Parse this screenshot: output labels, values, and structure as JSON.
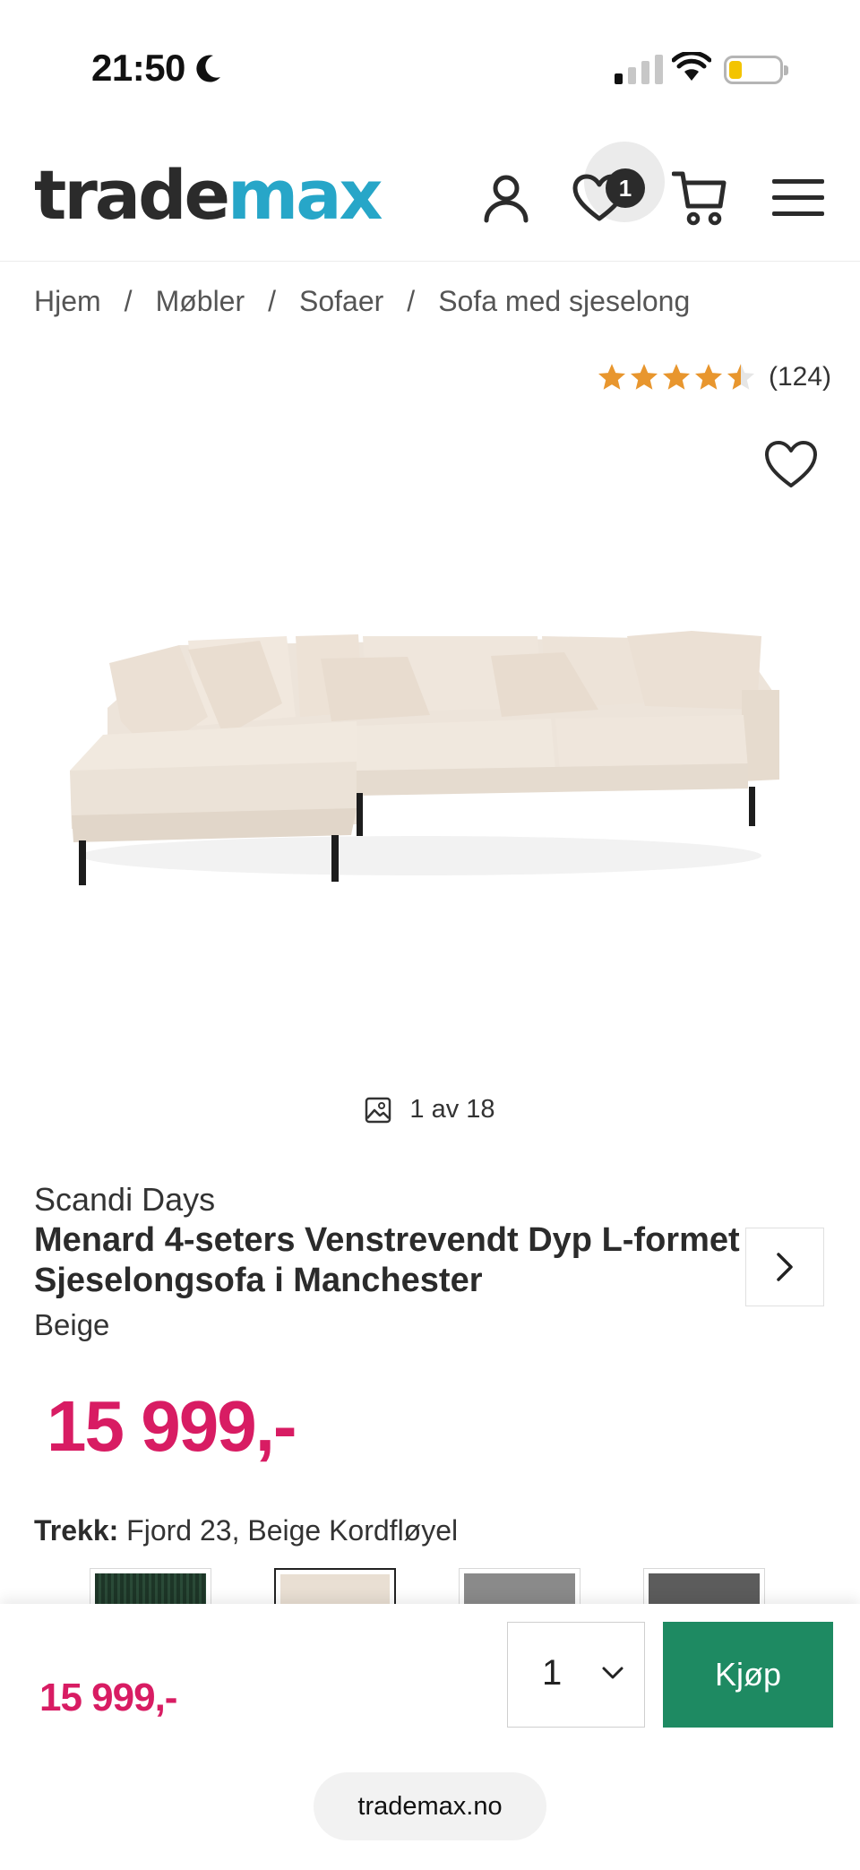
{
  "status_bar": {
    "time": "21:50"
  },
  "header": {
    "logo_part1": "trade",
    "logo_part2": "max",
    "wishlist_count": "1"
  },
  "breadcrumb": {
    "items": [
      "Hjem",
      "Møbler",
      "Sofaer",
      "Sofa med sjeselong"
    ],
    "separator": "/"
  },
  "rating": {
    "stars": 4.5,
    "count": "(124)"
  },
  "gallery": {
    "counter": "1 av 18"
  },
  "product": {
    "brand": "Scandi Days",
    "title": "Menard 4-seters Venstrevendt Dyp L-formet Sjeselongsofa i Manchester",
    "color": "Beige",
    "price": "15 999,-"
  },
  "upholstery": {
    "label": "Trekk:",
    "value": "Fjord 23, Beige Kordfløyel",
    "swatches": [
      {
        "name": "dark-green-corduroy",
        "color": "#1f3a2a",
        "selected": false
      },
      {
        "name": "beige-corduroy",
        "color": "#e9dfd3",
        "selected": true
      },
      {
        "name": "grey",
        "color": "#8a8a8a",
        "selected": false
      },
      {
        "name": "dark-grey",
        "color": "#5c5c5c",
        "selected": false
      }
    ]
  },
  "buy_bar": {
    "price": "15 999,-",
    "quantity": "1",
    "buy_label": "Kjøp"
  },
  "browser": {
    "url": "trademax.no"
  },
  "colors": {
    "brand_teal": "#27a6c8",
    "price_pink": "#d81c63",
    "buy_green": "#1e8a62",
    "star_orange": "#e8962e"
  }
}
